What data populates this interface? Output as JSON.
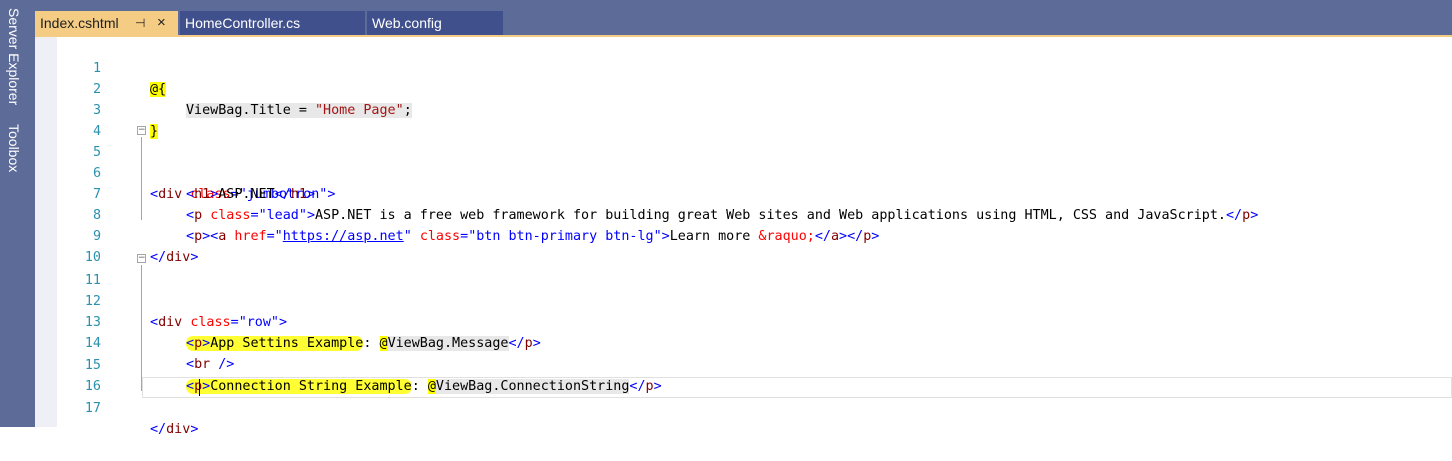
{
  "rail": {
    "items": [
      "Server Explorer",
      "Toolbox"
    ]
  },
  "tabs": [
    {
      "label": "Index.cshtml",
      "active": true,
      "pin": "⊣",
      "close": "×"
    },
    {
      "label": "HomeController.cs",
      "active": false
    },
    {
      "label": "Web.config",
      "active": false
    }
  ],
  "lines": [
    {
      "n": "1"
    },
    {
      "n": "2"
    },
    {
      "n": "3"
    },
    {
      "n": "4"
    },
    {
      "n": "5"
    },
    {
      "n": "6"
    },
    {
      "n": "7"
    },
    {
      "n": "8"
    },
    {
      "n": "9"
    },
    {
      "n": "10"
    },
    {
      "n": "11"
    },
    {
      "n": "12"
    },
    {
      "n": "13"
    },
    {
      "n": "14"
    },
    {
      "n": "15"
    },
    {
      "n": "16"
    },
    {
      "n": "17"
    }
  ],
  "code": {
    "l1": "@{",
    "l2_a": "ViewBag.Title = ",
    "l2_b": "\"Home Page\"",
    "l2_c": ";",
    "l3": "}",
    "l5_tag": "div",
    "l5_attr": "class",
    "l5_val": "\"jumbotron\"",
    "l6_tag": "h1",
    "l6_text": "ASP.NET",
    "l7_tag": "p",
    "l7_attr": "class",
    "l7_val": "\"lead\"",
    "l7_text": "ASP.NET is a free web framework for building great Web sites and Web applications using HTML, CSS and JavaScript.",
    "l8_p": "p",
    "l8_a": "a",
    "l8_href": "href",
    "l8_url": "https://asp.net",
    "l8_class": "class",
    "l8_classval": "\"btn btn-primary btn-lg\"",
    "l8_text": "Learn more ",
    "l8_entity": "&raquo;",
    "l9_tag": "div",
    "l11_tag": "div",
    "l11_attr": "class",
    "l11_val": "\"row\"",
    "l13_tag": "p",
    "l13_text": "App Settins Example",
    "l13_colon": ": ",
    "l13_at": "@",
    "l13_expr": "ViewBag.Message",
    "l14_tag": "br",
    "l15_tag": "p",
    "l15_text": "Connection String Example",
    "l15_colon": ": ",
    "l15_at": "@",
    "l15_expr": "ViewBag.ConnectionString",
    "l17_tag": "div"
  }
}
